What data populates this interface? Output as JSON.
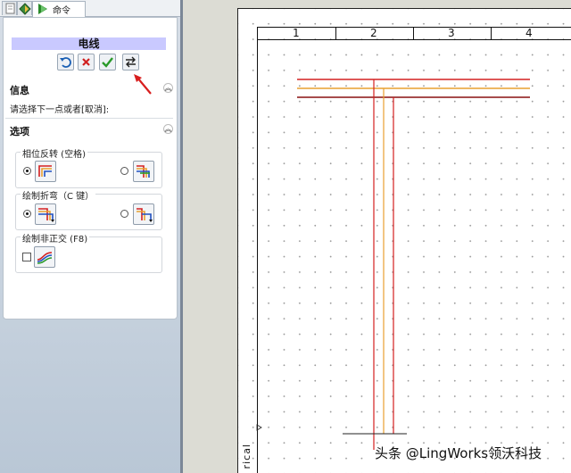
{
  "panel": {
    "tab_label": "命令",
    "command_title": "电线",
    "info_header": "信息",
    "info_text": "请选择下一点或者[取消]:",
    "options_header": "选项",
    "groups": [
      {
        "label": "相位反转 (空格)"
      },
      {
        "label": "绘制折弯（C 键）"
      },
      {
        "label": "绘制非正交 (F8)"
      }
    ]
  },
  "drawing": {
    "zone_numbers": [
      "1",
      "2",
      "3",
      "4"
    ],
    "vertical_label": "rical",
    "watermark": "头条 @LingWorks领沃科技"
  },
  "colors": {
    "wire_red": "#d42020",
    "wire_orange": "#e8a030",
    "wire_dark": "#8a1010",
    "title_bar": "#c9c9ff"
  },
  "icons": {
    "undo": "undo-icon",
    "cancel": "close-icon",
    "ok": "check-icon",
    "swap": "swap-icon"
  }
}
